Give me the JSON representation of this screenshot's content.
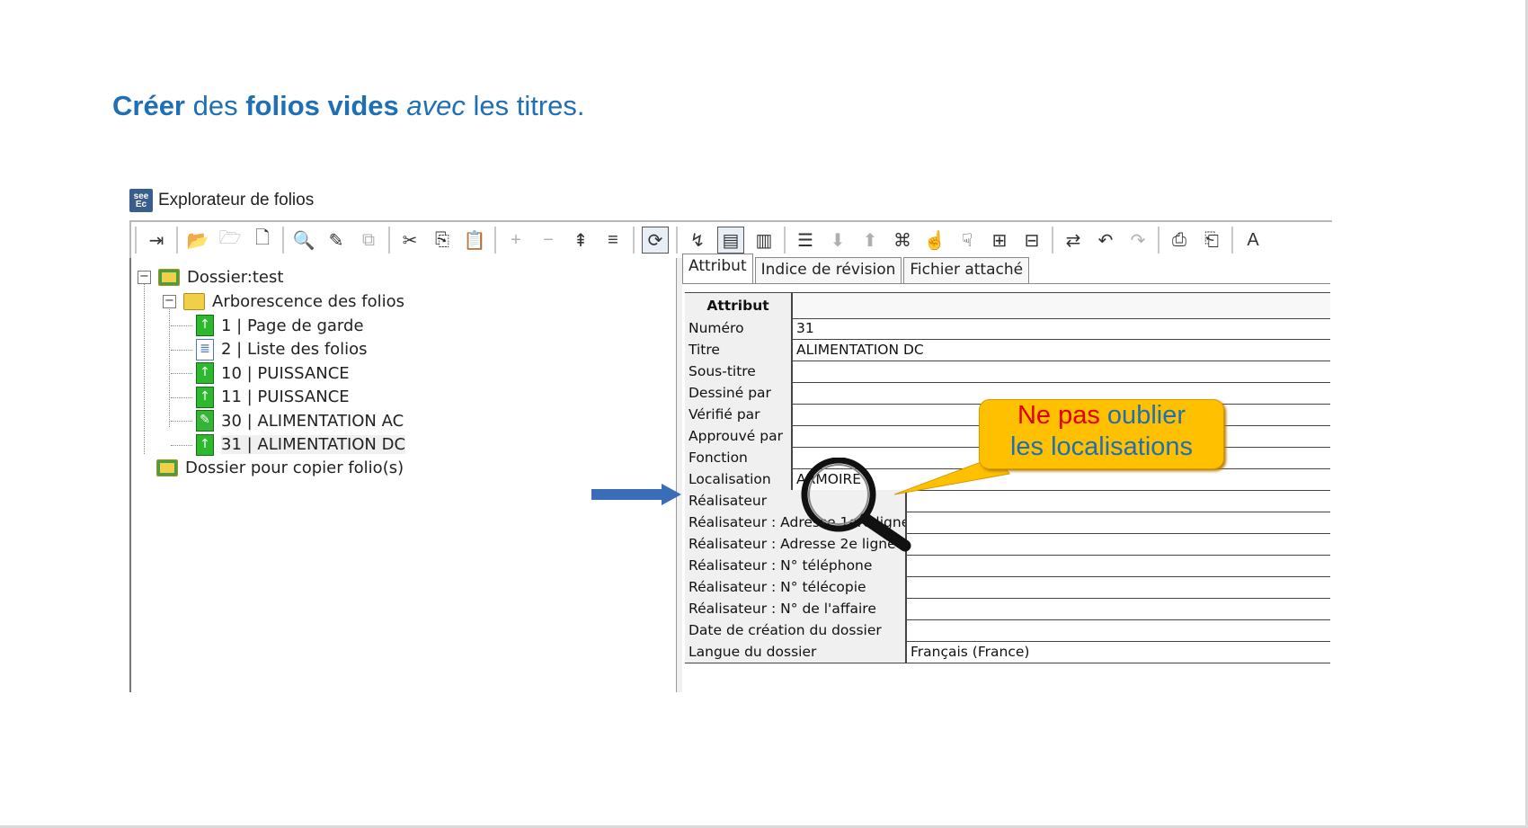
{
  "heading": {
    "part1": "Créer",
    "part2": " des ",
    "part3": "folios vides",
    "part4": " ",
    "part5": "avec",
    "part6": " les titres."
  },
  "window": {
    "title": "Explorateur de folios",
    "app_icon_text": "see Ec"
  },
  "toolbar": {
    "buttons": [
      {
        "icon": "exit-icon",
        "glyph": "⇥",
        "state": "normal"
      },
      {
        "icon": "open-folder-icon",
        "glyph": "📂",
        "state": "normal"
      },
      {
        "icon": "open-file-icon",
        "glyph": "🗁",
        "state": "dim"
      },
      {
        "icon": "new-file-icon",
        "glyph": "🗋",
        "state": "normal"
      },
      {
        "icon": "search-icon",
        "glyph": "🔍",
        "state": "normal"
      },
      {
        "icon": "edit-list-icon",
        "glyph": "✎",
        "state": "normal"
      },
      {
        "icon": "copy-pages-icon",
        "glyph": "⧉",
        "state": "dim"
      },
      {
        "icon": "cut-icon",
        "glyph": "✂",
        "state": "normal"
      },
      {
        "icon": "copy-icon",
        "glyph": "⎘",
        "state": "normal"
      },
      {
        "icon": "paste-icon",
        "glyph": "📋",
        "state": "dim"
      },
      {
        "icon": "plus-icon",
        "glyph": "+",
        "state": "dim"
      },
      {
        "icon": "minus-icon",
        "glyph": "−",
        "state": "dim"
      },
      {
        "icon": "expand-icon",
        "glyph": "⇞",
        "state": "normal"
      },
      {
        "icon": "collapse-icon",
        "glyph": "≡",
        "state": "normal"
      },
      {
        "icon": "refresh-icon",
        "glyph": "⟳",
        "state": "pressed"
      },
      {
        "icon": "link-icon",
        "glyph": "↯",
        "state": "normal"
      },
      {
        "icon": "view-panel-icon",
        "glyph": "▤",
        "state": "pressed"
      },
      {
        "icon": "view-columns-icon",
        "glyph": "▥",
        "state": "normal"
      },
      {
        "icon": "numbered-list-icon",
        "glyph": "☰",
        "state": "normal"
      },
      {
        "icon": "move-down-icon",
        "glyph": "⬇",
        "state": "dim"
      },
      {
        "icon": "move-up-icon",
        "glyph": "⬆",
        "state": "dim"
      },
      {
        "icon": "hierarchy-icon",
        "glyph": "⌘",
        "state": "normal"
      },
      {
        "icon": "hand-up-icon",
        "glyph": "☝",
        "state": "normal"
      },
      {
        "icon": "hand-down-icon",
        "glyph": "☟",
        "state": "normal"
      },
      {
        "icon": "attach-icon",
        "glyph": "⊞",
        "state": "normal"
      },
      {
        "icon": "attach-red-icon",
        "glyph": "⊟",
        "state": "normal"
      },
      {
        "icon": "swap-icon",
        "glyph": "⇄",
        "state": "normal"
      },
      {
        "icon": "undo-icon",
        "glyph": "↶",
        "state": "normal"
      },
      {
        "icon": "redo-icon",
        "glyph": "↷",
        "state": "dim"
      },
      {
        "icon": "export-icon",
        "glyph": "⎙",
        "state": "normal"
      },
      {
        "icon": "import-icon",
        "glyph": "⎗",
        "state": "normal"
      },
      {
        "icon": "font-icon",
        "glyph": "A",
        "state": "normal"
      }
    ]
  },
  "tree": {
    "root": "Dossier:test",
    "branch": "Arborescence des folios",
    "folios": [
      {
        "label": "1 | Page de garde",
        "kind": "green"
      },
      {
        "label": "2 | Liste des folios",
        "kind": "doc"
      },
      {
        "label": "10 | PUISSANCE",
        "kind": "green"
      },
      {
        "label": "11 | PUISSANCE",
        "kind": "green"
      },
      {
        "label": "30 | ALIMENTATION AC",
        "kind": "edit"
      },
      {
        "label": "31 | ALIMENTATION DC",
        "kind": "green"
      }
    ],
    "copy_folder": "Dossier pour copier folio(s)"
  },
  "tabs": [
    "Attribut",
    "Indice de révision",
    "Fichier attaché"
  ],
  "grid_header": "Attribut",
  "grid_rows_top": [
    {
      "label": "Numéro",
      "value": "31"
    },
    {
      "label": "Titre",
      "value": "ALIMENTATION DC"
    },
    {
      "label": "Sous-titre",
      "value": ""
    },
    {
      "label": "Dessiné par",
      "value": ""
    },
    {
      "label": "Vérifié par",
      "value": ""
    },
    {
      "label": "Approuvé par",
      "value": ""
    },
    {
      "label": "Fonction",
      "value": ""
    },
    {
      "label": "Localisation",
      "value": "ARMOIRE"
    }
  ],
  "grid_rows_bottom": [
    {
      "label": "Réalisateur",
      "value": ""
    },
    {
      "label": "Réalisateur : Adresse 1ere ligne",
      "value": ""
    },
    {
      "label": "Réalisateur : Adresse 2e ligne",
      "value": ""
    },
    {
      "label": "Réalisateur : N° téléphone",
      "value": ""
    },
    {
      "label": "Réalisateur : N° télécopie",
      "value": ""
    },
    {
      "label": "Réalisateur : N° de l'affaire",
      "value": ""
    },
    {
      "label": "Date de création du dossier",
      "value": ""
    },
    {
      "label": "Langue du dossier",
      "value": "Français (France)"
    }
  ],
  "callout": {
    "line1_red": "Ne pas",
    "line1_blue": " oublier",
    "line2_blue": "les localisations"
  },
  "colors": {
    "heading": "#1f6fb5",
    "callout_fill": "#ffc000",
    "arrow": "#3a6db8"
  }
}
